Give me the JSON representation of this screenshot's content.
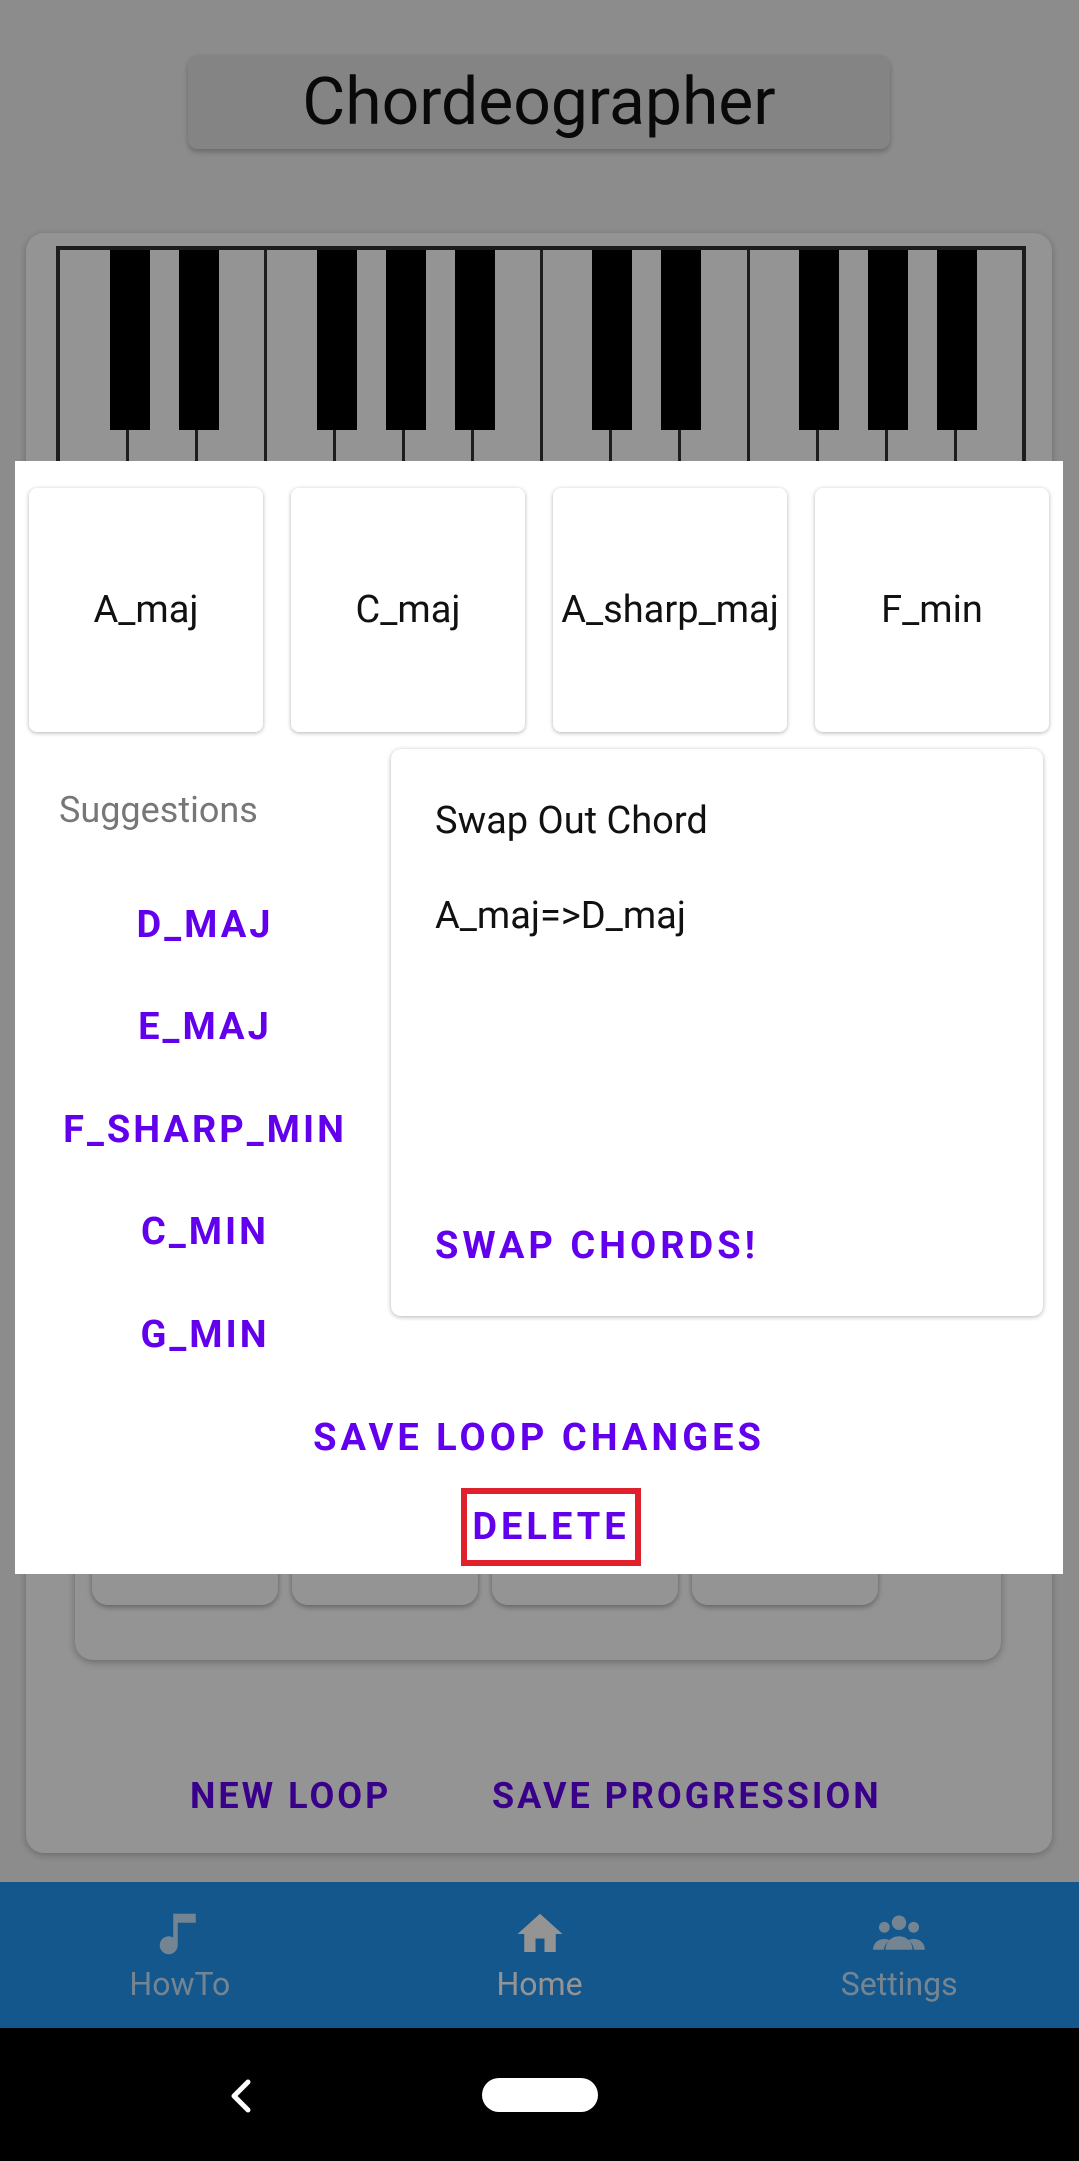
{
  "app": {
    "title": "Chordeographer",
    "buttons": {
      "new_loop": "NEW LOOP",
      "save_progression": "SAVE PROGRESSION"
    }
  },
  "bottom_nav": {
    "items": [
      {
        "label": "HowTo",
        "icon": "music-note-icon"
      },
      {
        "label": "Home",
        "icon": "home-icon"
      },
      {
        "label": "Settings",
        "icon": "people-icon"
      }
    ]
  },
  "dialog": {
    "chords": [
      "A_maj",
      "C_maj",
      "A_sharp_maj",
      "F_min"
    ],
    "suggestions_title": "Suggestions",
    "suggestions": [
      "D_MAJ",
      "E_MAJ",
      "F_SHARP_MIN",
      "C_MIN",
      "G_MIN"
    ],
    "swap": {
      "title": "Swap Out Chord",
      "value": "A_maj=>D_maj",
      "button": "SWAP CHORDS!"
    },
    "save_loop": "SAVE LOOP CHANGES",
    "delete": "DELETE"
  },
  "colors": {
    "accent": "#6200ee",
    "nav": "#2196f3",
    "highlight": "#e0202a"
  }
}
